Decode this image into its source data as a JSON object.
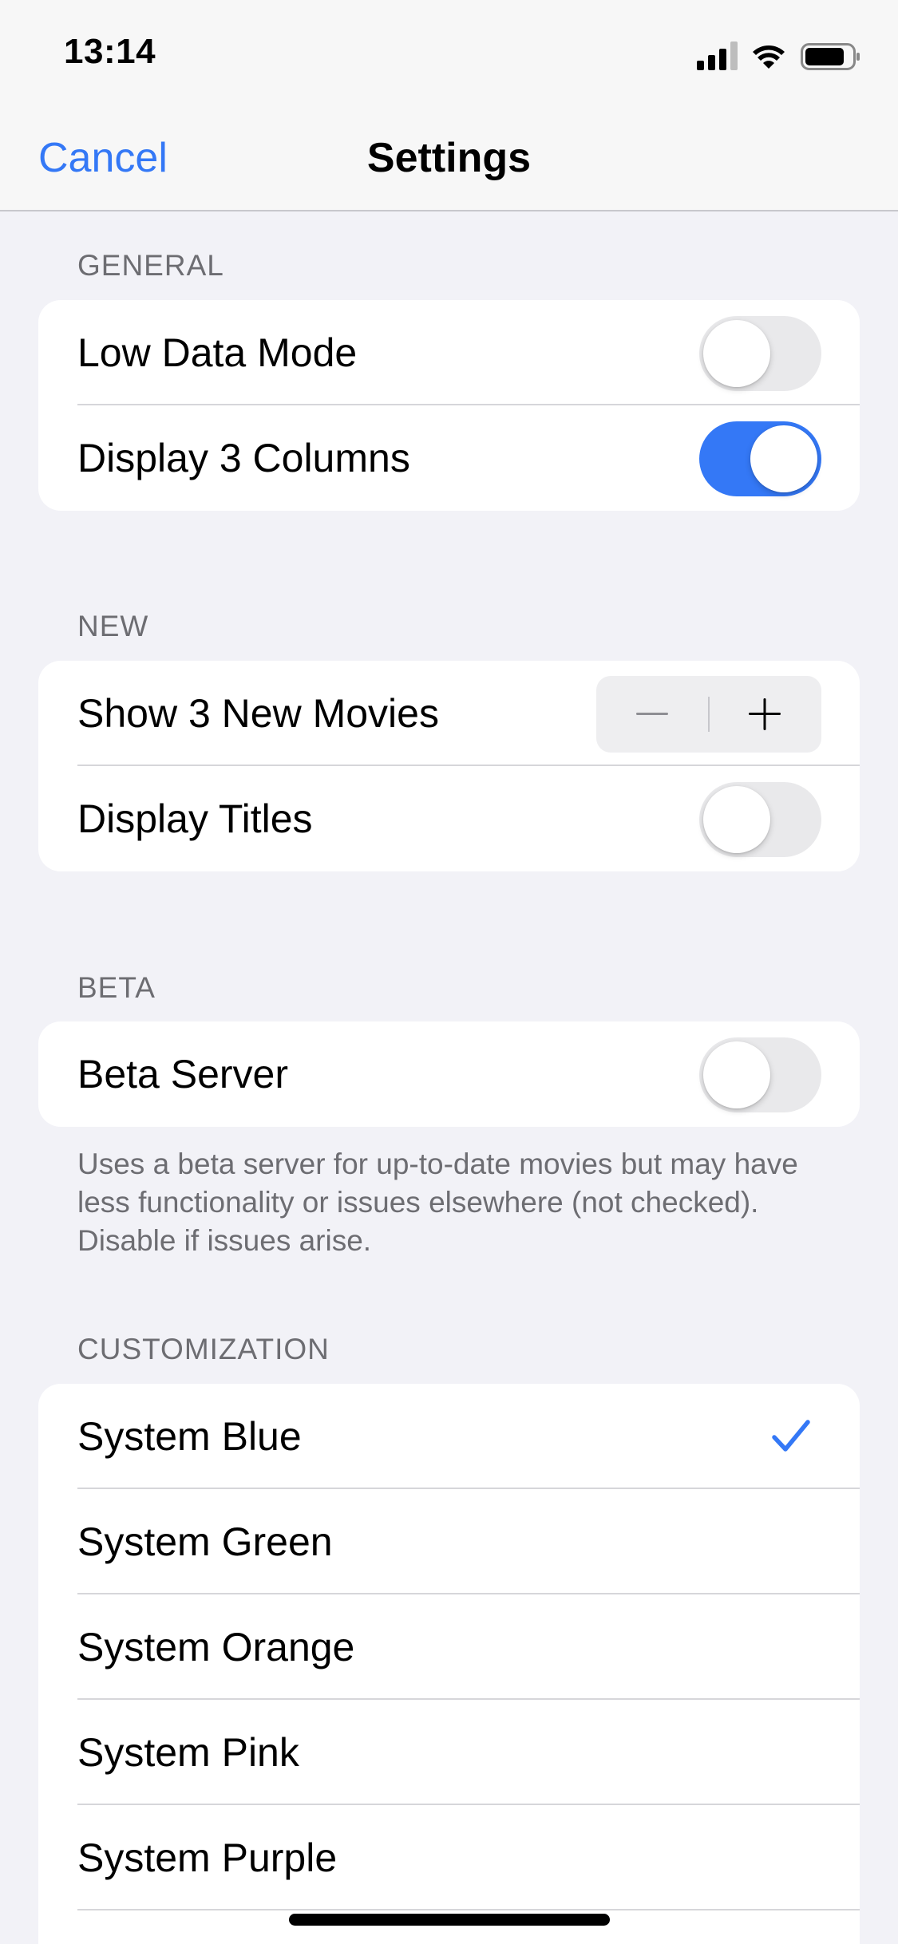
{
  "status_bar": {
    "time": "13:14",
    "icons": [
      "cellular-signal-icon",
      "wifi-icon",
      "battery-icon"
    ]
  },
  "nav": {
    "cancel_label": "Cancel",
    "title": "Settings"
  },
  "colors": {
    "accent": "#3478f6",
    "background": "#f2f2f7",
    "toggle_off": "#e9e9eb",
    "secondary_text": "#6d6d72"
  },
  "sections": {
    "general": {
      "header": "GENERAL",
      "rows": [
        {
          "label": "Low Data Mode",
          "toggle": false
        },
        {
          "label": "Display 3 Columns",
          "toggle": true
        }
      ]
    },
    "new": {
      "header": "NEW",
      "rows": [
        {
          "label": "Show 3 New Movies",
          "control": "stepper"
        },
        {
          "label": "Display Titles",
          "toggle": false
        }
      ]
    },
    "beta": {
      "header": "BETA",
      "rows": [
        {
          "label": "Beta Server",
          "toggle": false
        }
      ],
      "footer": "Uses a beta server for up-to-date movies but may have less functionality or issues elsewhere (not checked). Disable if issues arise."
    },
    "customization": {
      "header": "CUSTOMIZATION",
      "selected": "System Blue",
      "rows": [
        {
          "label": "System Blue",
          "checked": true
        },
        {
          "label": "System Green",
          "checked": false
        },
        {
          "label": "System Orange",
          "checked": false
        },
        {
          "label": "System Pink",
          "checked": false
        },
        {
          "label": "System Purple",
          "checked": false
        }
      ]
    }
  }
}
